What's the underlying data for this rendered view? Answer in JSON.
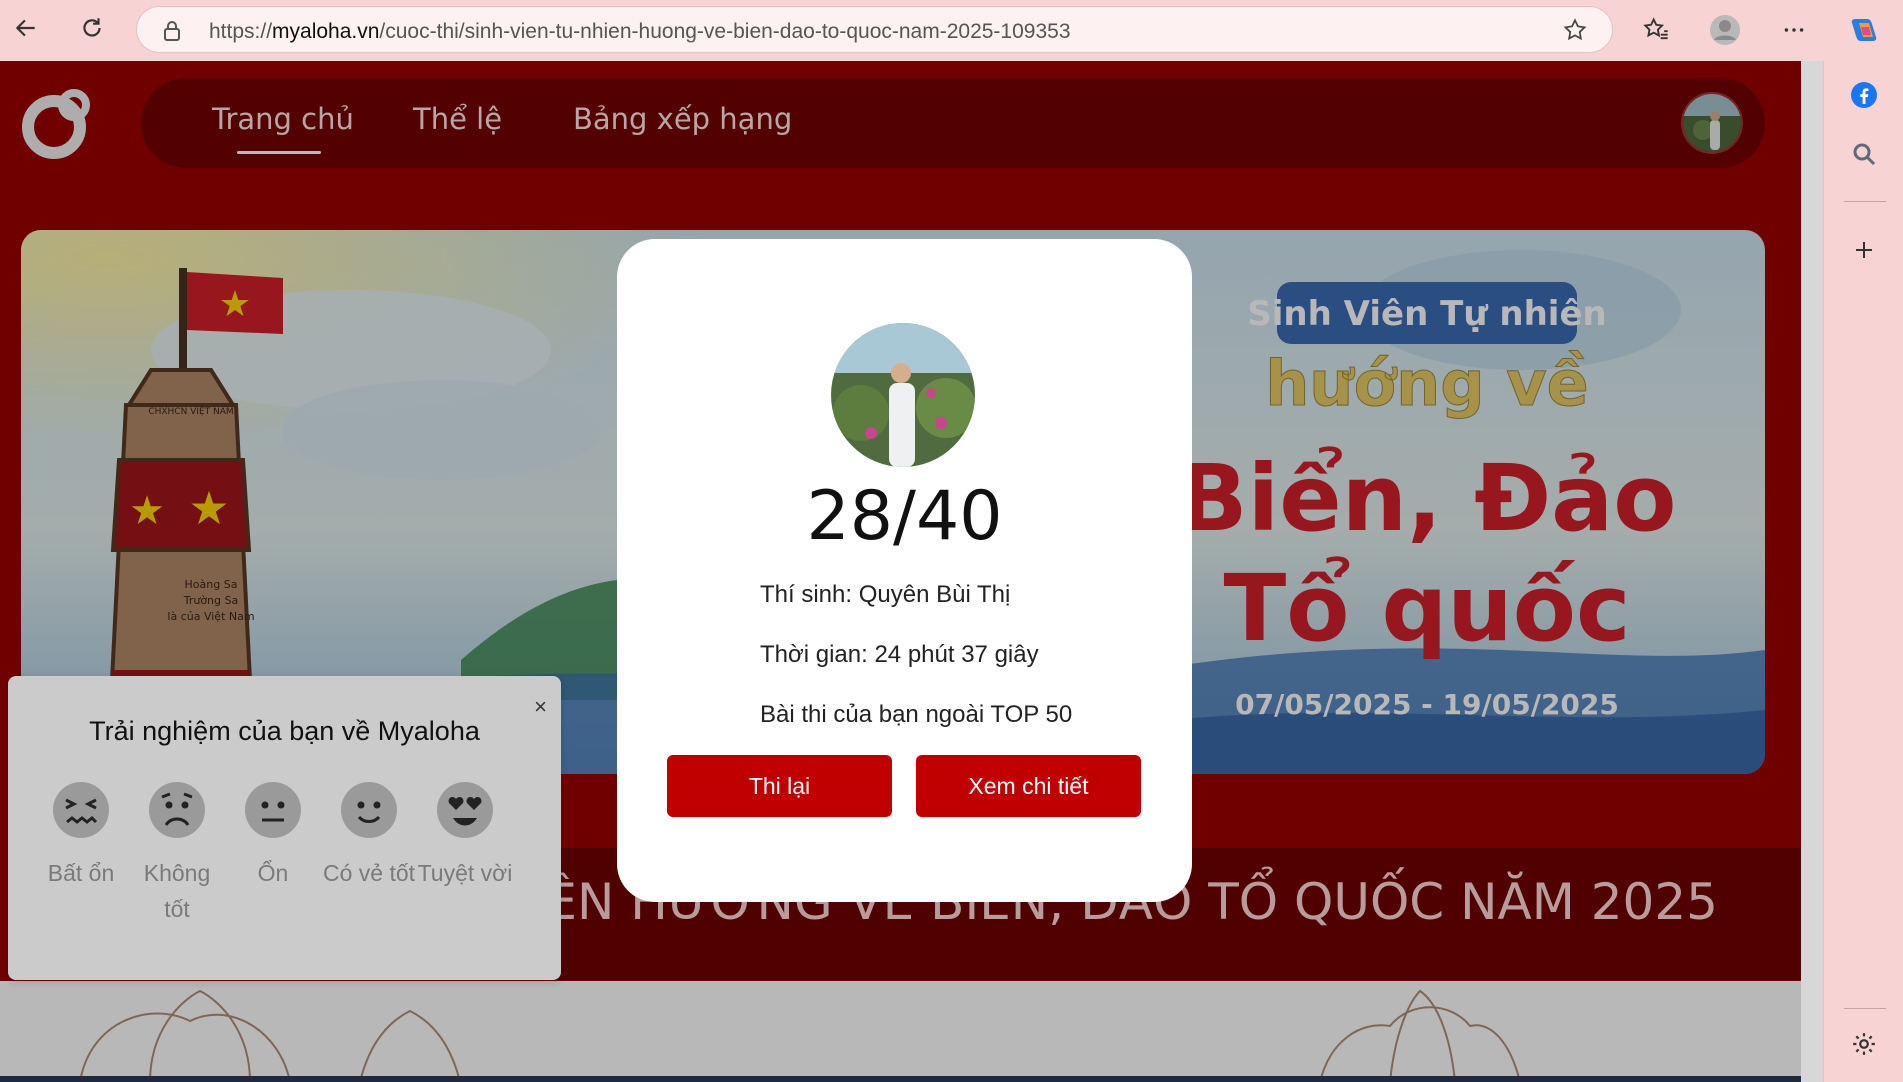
{
  "browser": {
    "url_domain": "myaloha.vn",
    "url_path": "/cuoc-thi/sinh-vien-tu-nhien-huong-ve-bien-dao-to-quoc-nam-2025-109353",
    "url_scheme": "https://"
  },
  "nav": {
    "items": [
      {
        "label": "Trang chủ",
        "active": true
      },
      {
        "label": "Thể lệ",
        "active": false
      },
      {
        "label": "Bảng xếp hạng",
        "active": false
      }
    ]
  },
  "banner": {
    "badge": "Sinh Viên Tự nhiên",
    "line2": "hướng về",
    "line3": "Biển, Đảo",
    "line4": "Tổ quốc",
    "dates": "07/05/2025 - 19/05/2025",
    "marker_top": "CHXHCN VIỆT NAM",
    "marker_bottom_1": "Hoàng Sa",
    "marker_bottom_2": "Trường Sa",
    "marker_bottom_3": "là của Việt Nam"
  },
  "contest_title": "SINH VIÊN TỰ NHIÊN HƯỚNG VỀ BIỂN, ĐẢO TỔ QUỐC NĂM 2025",
  "result": {
    "score": "28/40",
    "contestant": "Thí sinh: Quyên Bùi Thị",
    "time": "Thời gian: 24 phút 37 giây",
    "rank_note": "Bài thi của bạn ngoài TOP 50",
    "retry_label": "Thi lại",
    "details_label": "Xem chi tiết"
  },
  "feedback": {
    "title": "Trải nghiệm của bạn về Myaloha",
    "close": "×",
    "options": [
      {
        "label": "Bất ổn",
        "icon": "confounded-face-icon"
      },
      {
        "label": "Không tốt",
        "icon": "worried-face-icon"
      },
      {
        "label": "Ổn",
        "icon": "neutral-face-icon"
      },
      {
        "label": "Có vẻ tốt",
        "icon": "slight-smile-icon"
      },
      {
        "label": "Tuyệt vời",
        "icon": "heart-eyes-icon"
      }
    ]
  },
  "colors": {
    "page_red": "#9c0000",
    "nav_dark": "#720000",
    "button_red": "#c00000"
  }
}
